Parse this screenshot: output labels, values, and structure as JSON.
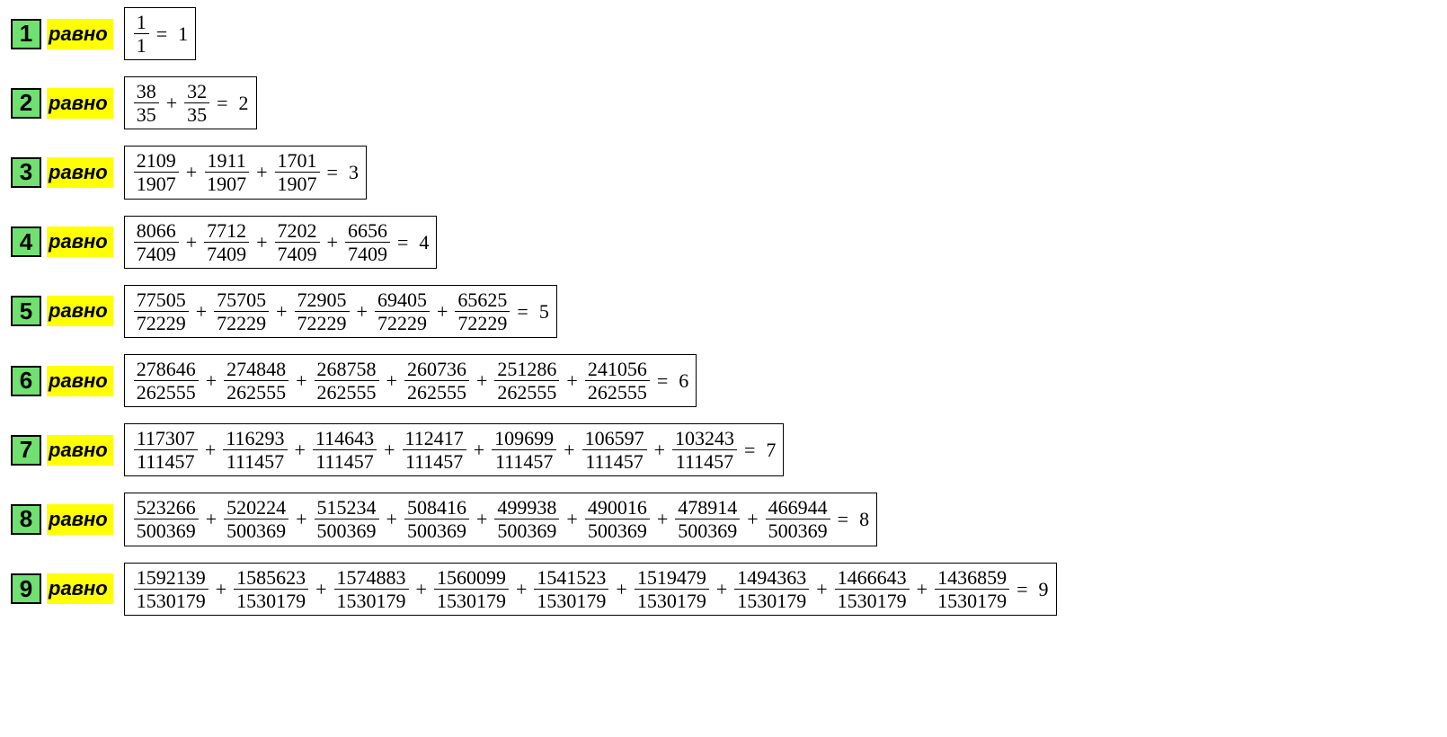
{
  "label_word": "равно",
  "rows": [
    {
      "index": "1",
      "fractions": [
        {
          "n": "1",
          "d": "1"
        }
      ],
      "result": "1"
    },
    {
      "index": "2",
      "fractions": [
        {
          "n": "38",
          "d": "35"
        },
        {
          "n": "32",
          "d": "35"
        }
      ],
      "result": "2"
    },
    {
      "index": "3",
      "fractions": [
        {
          "n": "2109",
          "d": "1907"
        },
        {
          "n": "1911",
          "d": "1907"
        },
        {
          "n": "1701",
          "d": "1907"
        }
      ],
      "result": "3"
    },
    {
      "index": "4",
      "fractions": [
        {
          "n": "8066",
          "d": "7409"
        },
        {
          "n": "7712",
          "d": "7409"
        },
        {
          "n": "7202",
          "d": "7409"
        },
        {
          "n": "6656",
          "d": "7409"
        }
      ],
      "result": "4"
    },
    {
      "index": "5",
      "fractions": [
        {
          "n": "77505",
          "d": "72229"
        },
        {
          "n": "75705",
          "d": "72229"
        },
        {
          "n": "72905",
          "d": "72229"
        },
        {
          "n": "69405",
          "d": "72229"
        },
        {
          "n": "65625",
          "d": "72229"
        }
      ],
      "result": "5"
    },
    {
      "index": "6",
      "fractions": [
        {
          "n": "278646",
          "d": "262555"
        },
        {
          "n": "274848",
          "d": "262555"
        },
        {
          "n": "268758",
          "d": "262555"
        },
        {
          "n": "260736",
          "d": "262555"
        },
        {
          "n": "251286",
          "d": "262555"
        },
        {
          "n": "241056",
          "d": "262555"
        }
      ],
      "result": "6"
    },
    {
      "index": "7",
      "fractions": [
        {
          "n": "117307",
          "d": "111457"
        },
        {
          "n": "116293",
          "d": "111457"
        },
        {
          "n": "114643",
          "d": "111457"
        },
        {
          "n": "112417",
          "d": "111457"
        },
        {
          "n": "109699",
          "d": "111457"
        },
        {
          "n": "106597",
          "d": "111457"
        },
        {
          "n": "103243",
          "d": "111457"
        }
      ],
      "result": "7"
    },
    {
      "index": "8",
      "fractions": [
        {
          "n": "523266",
          "d": "500369"
        },
        {
          "n": "520224",
          "d": "500369"
        },
        {
          "n": "515234",
          "d": "500369"
        },
        {
          "n": "508416",
          "d": "500369"
        },
        {
          "n": "499938",
          "d": "500369"
        },
        {
          "n": "490016",
          "d": "500369"
        },
        {
          "n": "478914",
          "d": "500369"
        },
        {
          "n": "466944",
          "d": "500369"
        }
      ],
      "result": "8"
    },
    {
      "index": "9",
      "fractions": [
        {
          "n": "1592139",
          "d": "1530179"
        },
        {
          "n": "1585623",
          "d": "1530179"
        },
        {
          "n": "1574883",
          "d": "1530179"
        },
        {
          "n": "1560099",
          "d": "1530179"
        },
        {
          "n": "1541523",
          "d": "1530179"
        },
        {
          "n": "1519479",
          "d": "1530179"
        },
        {
          "n": "1494363",
          "d": "1530179"
        },
        {
          "n": "1466643",
          "d": "1530179"
        },
        {
          "n": "1436859",
          "d": "1530179"
        }
      ],
      "result": "9"
    }
  ]
}
